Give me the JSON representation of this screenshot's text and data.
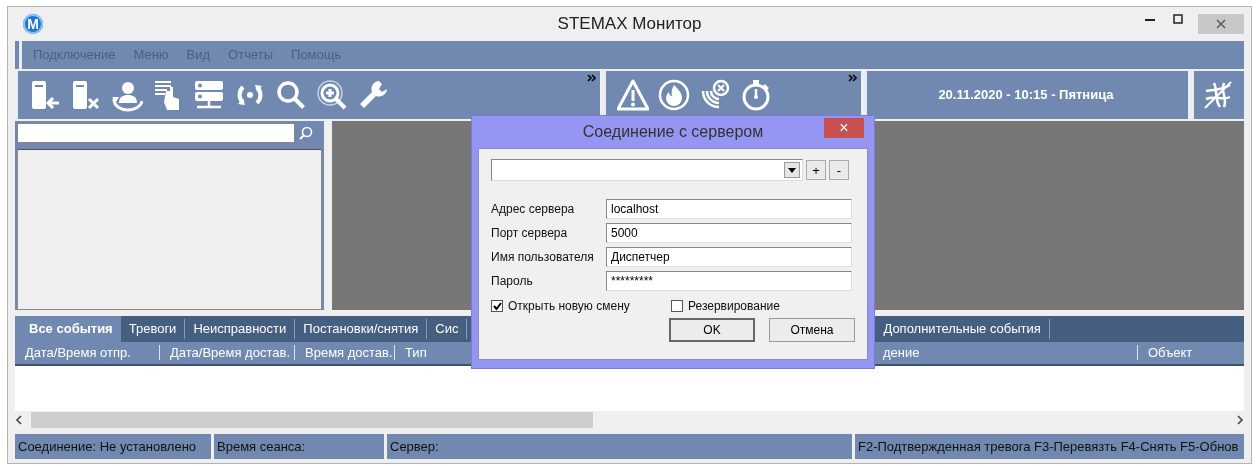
{
  "window": {
    "logo": "M",
    "title": "STEMAX Монитор"
  },
  "menu": [
    {
      "label": "Подключение",
      "disabled": true
    },
    {
      "label": "Меню",
      "disabled": true
    },
    {
      "label": "Вид",
      "disabled": true
    },
    {
      "label": "Отчеты",
      "disabled": true
    },
    {
      "label": "Помощь",
      "disabled": true
    }
  ],
  "clock": "20.11.2020 - 10:15 - Пятница",
  "tabs": [
    {
      "label": "Все события",
      "selected": true
    },
    {
      "label": "Тревоги",
      "selected": false
    },
    {
      "label": "Неисправности",
      "selected": false
    },
    {
      "label": "Постановки/снятия",
      "selected": false
    },
    {
      "label": "Сис",
      "selected": false
    },
    {
      "label": "Дополнительные события",
      "selected": false
    }
  ],
  "columns": [
    "Дата/Время отпр.",
    "Дата/Время достав.",
    "Время достав.",
    "Тип",
    "дение",
    "Объект"
  ],
  "status_bar": [
    "Соединение: Не установлено",
    "Время сеанса:",
    "Сервер:",
    "F2-Подтвержденная тревога  F3-Перевязть F4-Снять F5-Обнов"
  ],
  "dialog": {
    "title": "Соединение с сервером",
    "close": "×",
    "combo_buttons": [
      "+",
      "-"
    ],
    "fields": [
      {
        "label": "Адрес сервера",
        "value": "localhost"
      },
      {
        "label": "Порт сервера",
        "value": "5000"
      },
      {
        "label": "Имя пользователя",
        "value": "Диспетчер"
      },
      {
        "label": "Пароль",
        "value": "*********"
      }
    ],
    "checkboxes": [
      {
        "label": "Открыть новую смену",
        "checked": true
      },
      {
        "label": "Резервирование",
        "checked": false
      }
    ],
    "buttons": [
      {
        "label": "OK",
        "default": true
      },
      {
        "label": "Отмена",
        "default": false
      }
    ]
  }
}
